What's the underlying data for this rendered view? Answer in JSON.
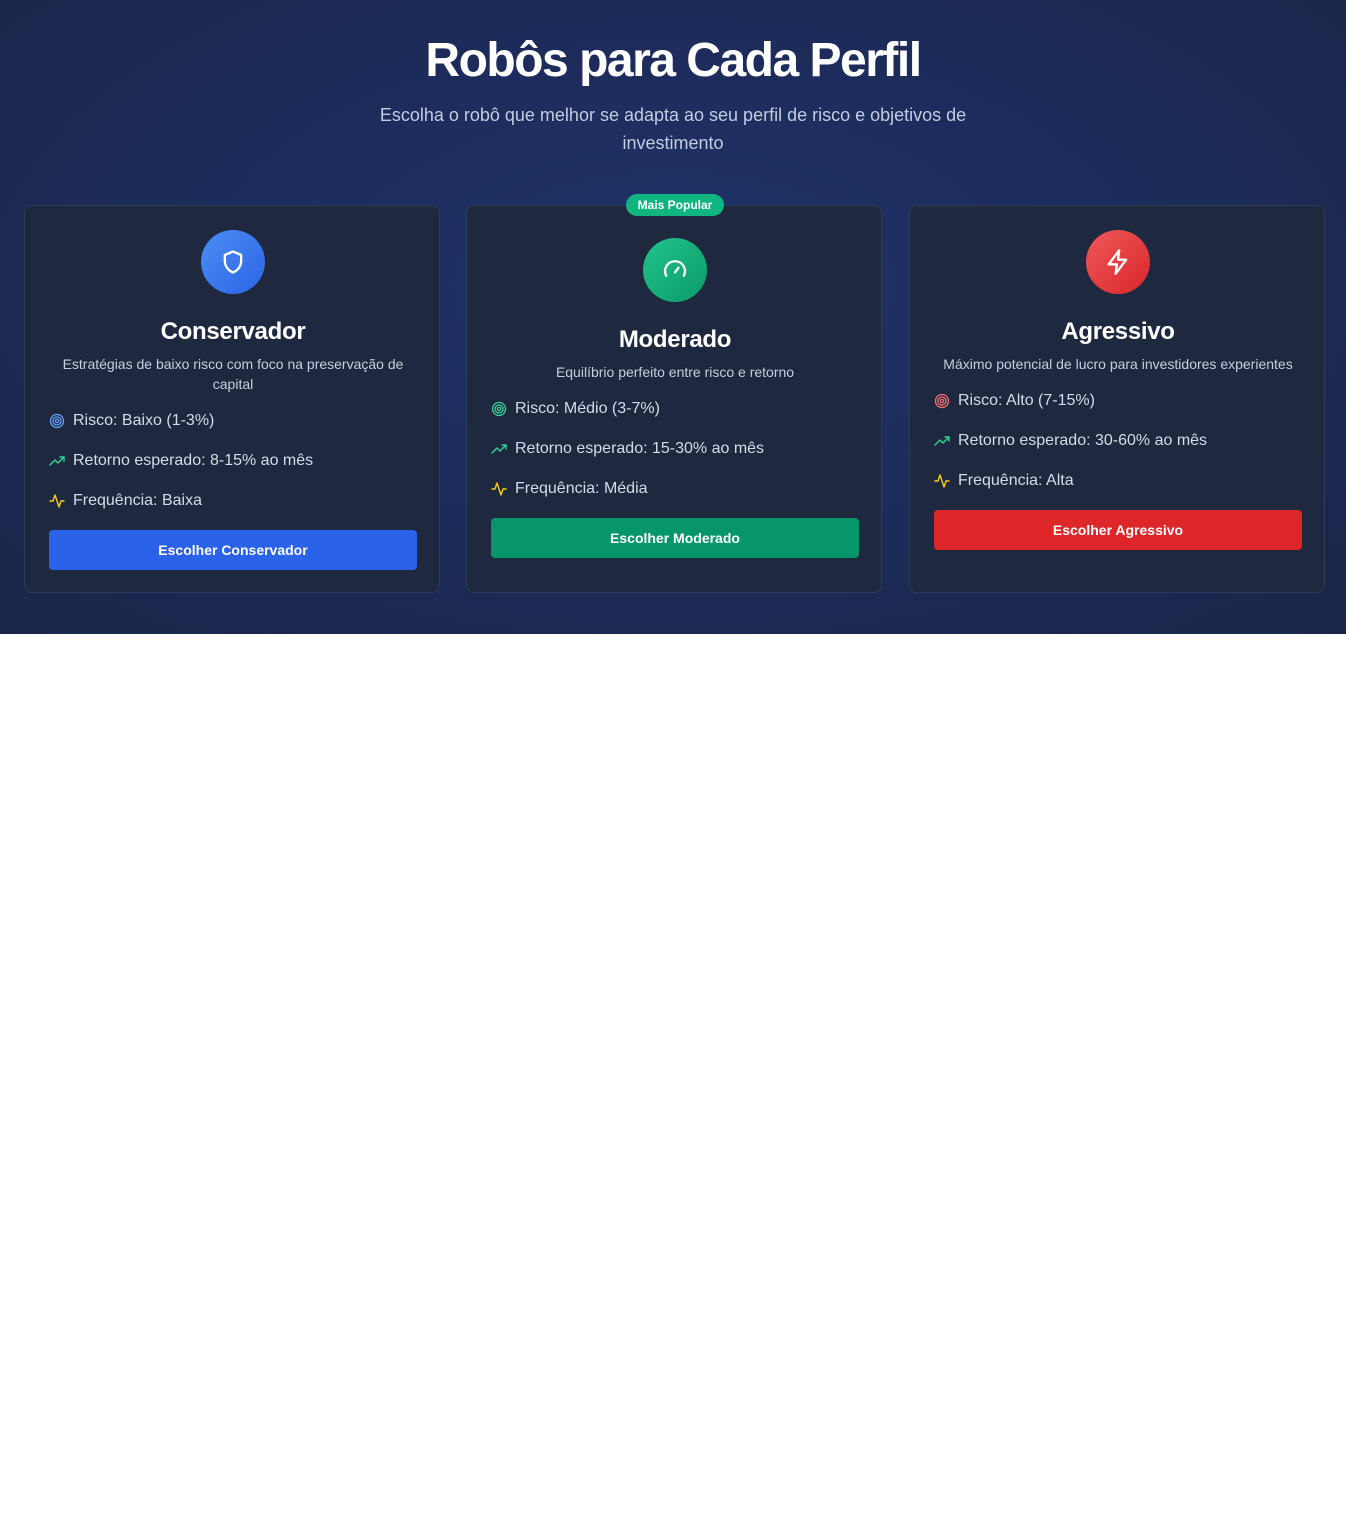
{
  "hero": {
    "title": "Robôs para Cada Perfil",
    "subtitle": "Escolha o robô que melhor se adapta ao seu perfil de risco e objetivos de investimento"
  },
  "badge": "Mais Popular",
  "colors": {
    "blue": "#2a62e8",
    "green": "#06966a",
    "red": "#dc2627",
    "trend_icon": "#34d399",
    "activity_icon": "#facc15"
  },
  "cards": [
    {
      "icon": "shield-icon",
      "name": "Conservador",
      "description": "Estratégias de baixo risco com foco na preservação de capital",
      "risk": "Risco: Baixo (1-3%)",
      "return": "Retorno esperado: 8-15% ao mês",
      "frequency": "Frequência: Baixa",
      "button": "Escolher Conservador"
    },
    {
      "icon": "gauge-icon",
      "name": "Moderado",
      "description": "Equilíbrio perfeito entre risco e retorno",
      "risk": "Risco: Médio (3-7%)",
      "return": "Retorno esperado: 15-30% ao mês",
      "frequency": "Frequência: Média",
      "button": "Escolher Moderado"
    },
    {
      "icon": "lightning-icon",
      "name": "Agressivo",
      "description": "Máximo potencial de lucro para investidores experientes",
      "risk": "Risco: Alto (7-15%)",
      "return": "Retorno esperado: 30-60% ao mês",
      "frequency": "Frequência: Alta",
      "button": "Escolher Agressivo"
    }
  ]
}
